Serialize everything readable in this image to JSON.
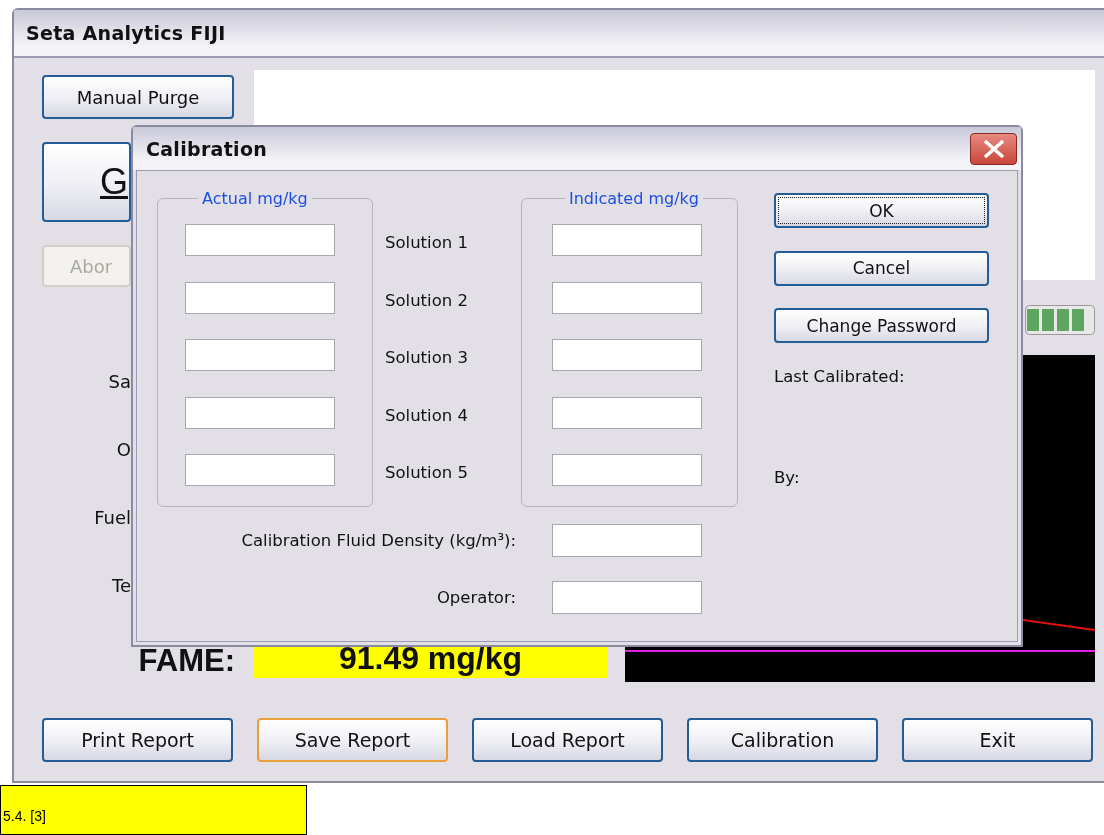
{
  "window": {
    "title": "Seta Analytics FIJI"
  },
  "side_buttons": [
    {
      "label": "Manual Purge",
      "kind": "normal",
      "disabled": false
    },
    {
      "label": "G",
      "kind": "large",
      "disabled": false
    },
    {
      "label": "Abor",
      "kind": "clipped",
      "disabled": true
    }
  ],
  "parameter_labels": [
    "Sa",
    "O",
    "Fuel",
    "Te"
  ],
  "fame": {
    "label": "FAME:",
    "value": "91.49 mg/kg"
  },
  "bottom_buttons": [
    {
      "label": "Print Report",
      "focused": false
    },
    {
      "label": "Save Report",
      "focused": true
    },
    {
      "label": "Load Report",
      "focused": false
    },
    {
      "label": "Calibration",
      "focused": false
    },
    {
      "label": "Exit",
      "focused": false
    }
  ],
  "dialog": {
    "title": "Calibration",
    "actual_legend": "Actual mg/kg",
    "indicated_legend": "Indicated mg/kg",
    "solutions": [
      "Solution 1",
      "Solution 2",
      "Solution 3",
      "Solution 4",
      "Solution 5"
    ],
    "density_label": "Calibration Fluid Density (kg/m³):",
    "operator_label": "Operator:",
    "buttons": [
      {
        "label": "OK",
        "focused": true
      },
      {
        "label": "Cancel",
        "focused": false
      },
      {
        "label": "Change Password",
        "focused": false
      }
    ],
    "last_calibrated_label": "Last Calibrated:",
    "by_label": "By:"
  },
  "caption": "5.4. [3]"
}
